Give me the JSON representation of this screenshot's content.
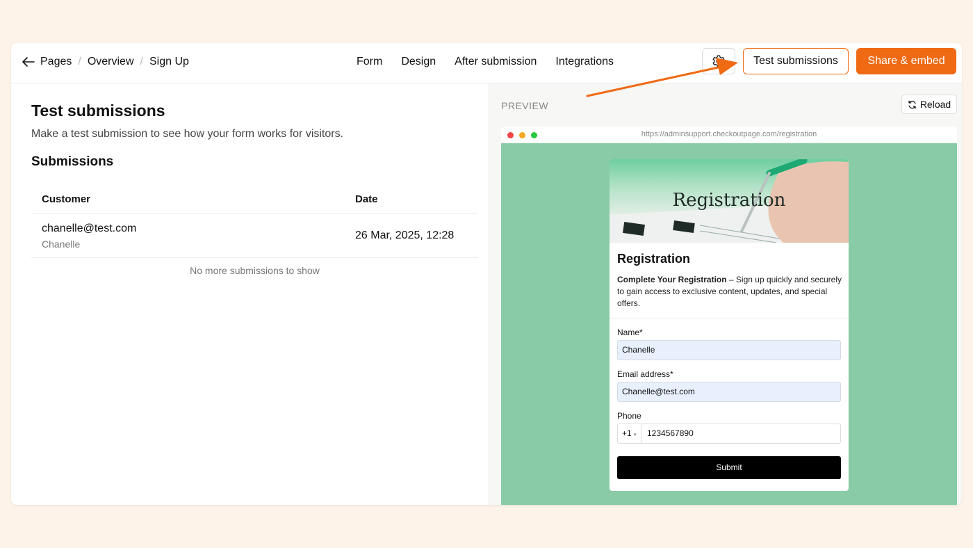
{
  "breadcrumb": {
    "items": [
      "Pages",
      "Overview",
      "Sign Up"
    ]
  },
  "nav": {
    "tabs": [
      "Form",
      "Design",
      "After submission",
      "Integrations"
    ]
  },
  "toolbar": {
    "test_label": "Test submissions",
    "share_label": "Share & embed"
  },
  "colors": {
    "accent": "#f06a14",
    "preview_bg": "#88cba6"
  },
  "main": {
    "title": "Test submissions",
    "subtitle": "Make a test submission to see how your form works for visitors.",
    "section": "Submissions",
    "columns": [
      "Customer",
      "Date"
    ],
    "rows": [
      {
        "email": "chanelle@test.com",
        "name": "Chanelle",
        "date": "26 Mar, 2025, 12:28"
      }
    ],
    "empty_note": "No more submissions to show"
  },
  "preview": {
    "label": "PREVIEW",
    "reload_label": "Reload",
    "url": "https://adminsupport.checkoutpage.com/registration",
    "banner_title": "Registration",
    "form_title": "Registration",
    "desc_bold": "Complete Your Registration",
    "desc_rest": " – Sign up quickly and securely to gain access to exclusive content, updates, and special offers.",
    "fields": {
      "name_label": "Name",
      "name_value": "Chanelle",
      "email_label": "Email address",
      "email_value": "Chanelle@test.com",
      "phone_label": "Phone",
      "phone_code": "+1",
      "phone_value": "1234567890"
    },
    "required_mark": "*",
    "submit_label": "Submit"
  }
}
